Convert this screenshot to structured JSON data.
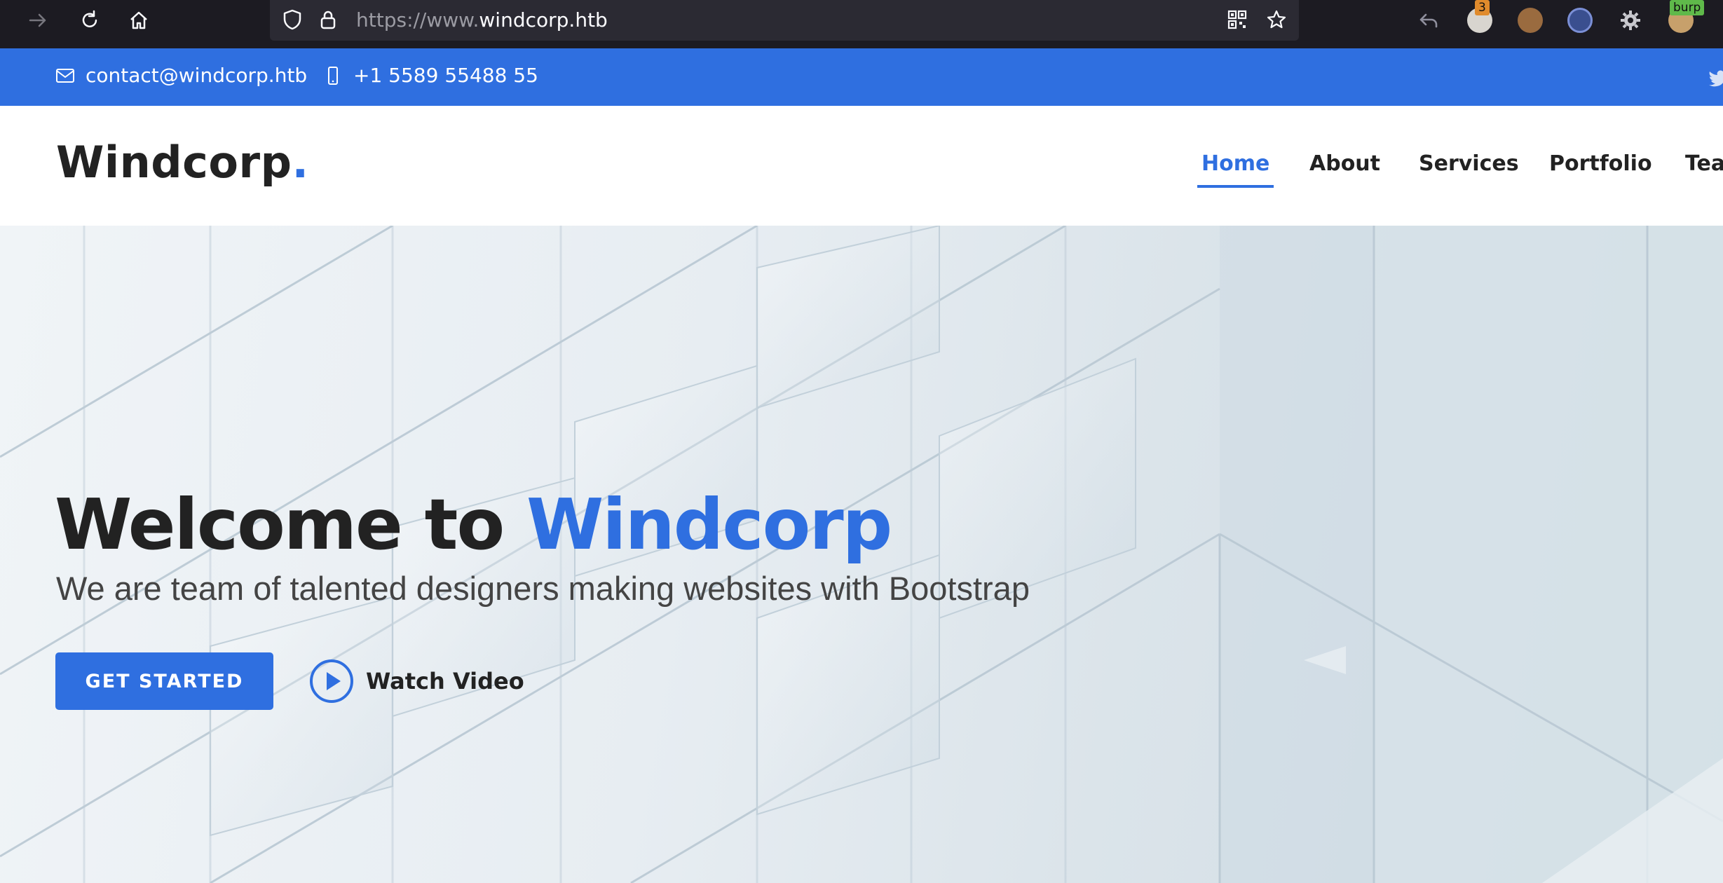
{
  "browser": {
    "url_prefix": "https://www.",
    "url_host": "windcorp.htb",
    "toolbar_icons": [
      "forward-icon",
      "reload-icon",
      "home-icon",
      "tracking-shield-icon",
      "lock-icon",
      "qr-code-icon",
      "bookmark-star-icon",
      "back-arrow-icon",
      "extension-icon",
      "monkey-extension-icon",
      "globe-extension-icon",
      "settings-gear-icon",
      "burp-extension-icon"
    ],
    "extension_badge_count": "3",
    "burp_badge": "burp"
  },
  "topbar": {
    "email": "contact@windcorp.htb",
    "phone": "+1 5589 55488 55",
    "icons": [
      "envelope-icon",
      "mobile-phone-icon",
      "twitter-icon"
    ]
  },
  "header": {
    "logo_text": "Windcorp",
    "logo_dot": ".",
    "nav": {
      "home": "Home",
      "about": "About",
      "services": "Services",
      "portfolio": "Portfolio",
      "team": "Tea"
    }
  },
  "hero": {
    "title_prefix": "Welcome to ",
    "title_brand": "Windcorp",
    "subtitle": "We are team of talented designers making websites with Bootstrap",
    "cta_label": "GET STARTED",
    "video_label": "Watch Video"
  },
  "colors": {
    "accent": "#2f6fe0",
    "dark_text": "#222222",
    "browser_chrome": "#1c1b22"
  }
}
